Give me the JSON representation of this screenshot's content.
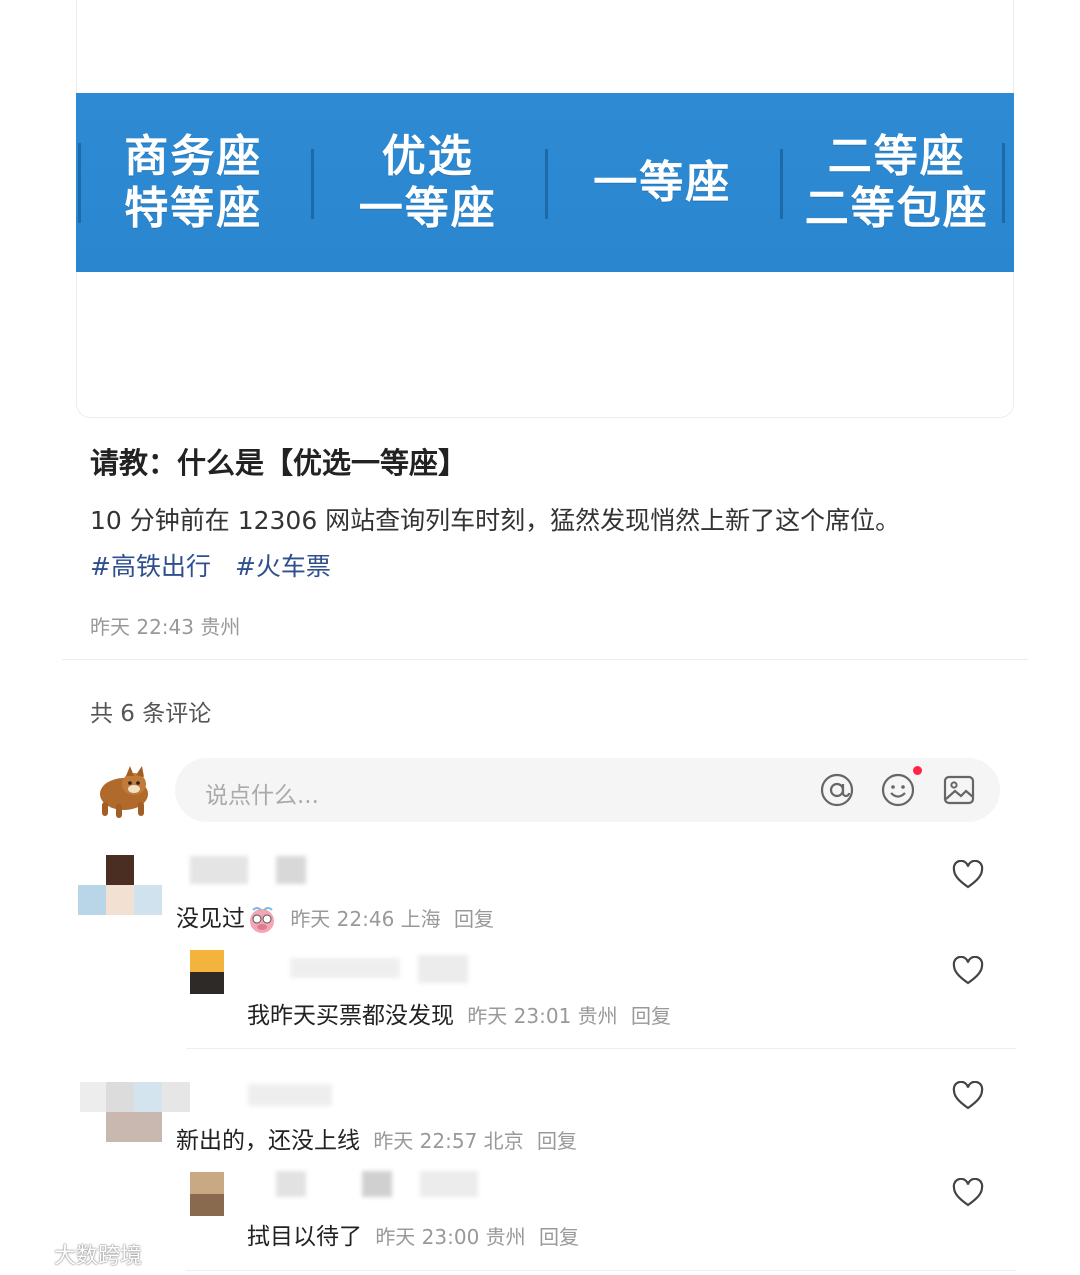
{
  "banner": {
    "columns": [
      {
        "line1": "商务座",
        "line2": "特等座"
      },
      {
        "line1": "优选",
        "line2": "一等座"
      },
      {
        "line1": "一等座",
        "line2": ""
      },
      {
        "line1": "二等座",
        "line2": "二等包座"
      }
    ],
    "color": "#2e8bd3"
  },
  "post": {
    "title": "请教：什么是【优选一等座】",
    "body": "10 分钟前在 12306 网站查询列车时刻，猛然发现悄然上新了这个席位。",
    "tags": [
      "#高铁出行",
      "#火车票"
    ],
    "meta": "昨天 22:43 贵州"
  },
  "comments_header": "共 6 条评论",
  "input": {
    "placeholder": "说点什么...",
    "icons": [
      "at-icon",
      "emoji-icon",
      "image-icon"
    ]
  },
  "comments": [
    {
      "text": "没见过",
      "meta": "昨天 22:46 上海",
      "reply": "回复"
    },
    {
      "text": "我昨天买票都没发现",
      "meta": "昨天 23:01 贵州",
      "reply": "回复"
    },
    {
      "text": "新出的，还没上线",
      "meta": "昨天 22:57 北京",
      "reply": "回复"
    },
    {
      "text": "拭目以待了",
      "meta": "昨天 23:00 贵州",
      "reply": "回复"
    }
  ],
  "watermark": "大数跨境"
}
